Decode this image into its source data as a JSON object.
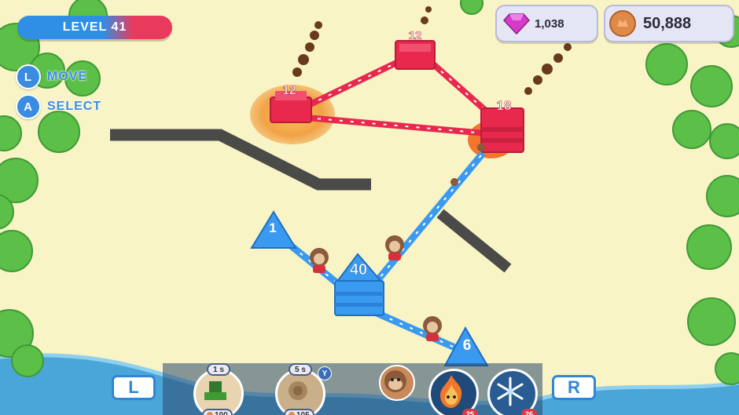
{
  "hud": {
    "level_text": "LEVEL 41",
    "controls": [
      {
        "button": "L",
        "label": "MOVE"
      },
      {
        "button": "A",
        "label": "SELECT"
      }
    ],
    "gems": "1,038",
    "coins": "50,888"
  },
  "bases": {
    "red_left": "12",
    "red_top": "12",
    "red_right": "18",
    "blue_left": "1",
    "blue_center": "40",
    "blue_bottom": "6"
  },
  "abilities": [
    {
      "timer": "1 s",
      "cost": "100"
    },
    {
      "timer": "5 s",
      "cost": "105"
    }
  ],
  "y_button": "Y",
  "powerups": [
    {
      "count": "25"
    },
    {
      "count": "26"
    }
  ],
  "shoulder_buttons": {
    "left": "L",
    "right": "R"
  },
  "colors": {
    "ground": "#f8f4c6",
    "red_team": "#e8294d",
    "blue_team": "#3a9af0",
    "wall": "#4a4a48",
    "river": "#4aa6d8",
    "tree": "#5cbf48"
  }
}
